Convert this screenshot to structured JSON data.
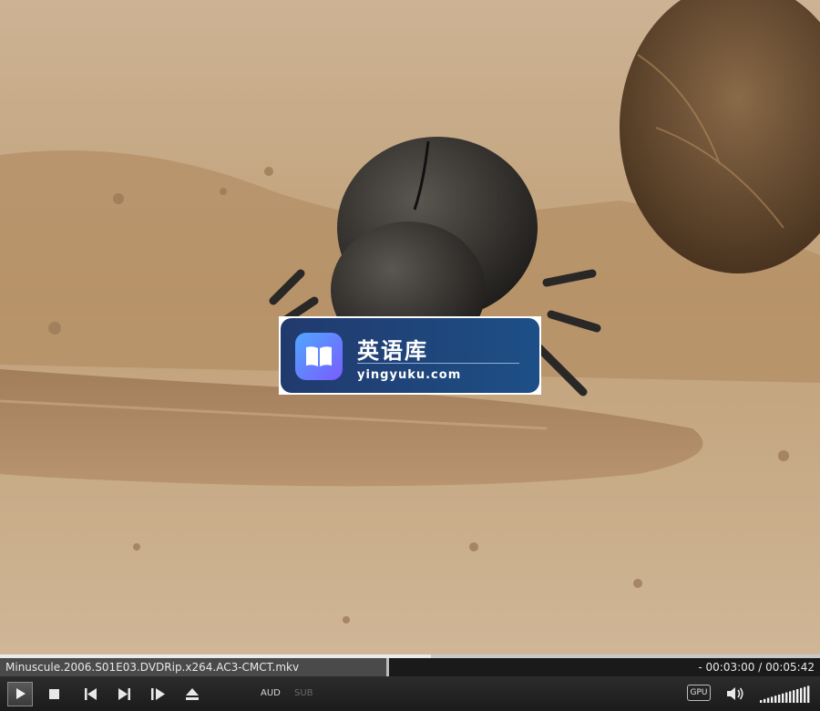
{
  "player": {
    "filename": "Minuscule.2006.S01E03.DVDRip.x264.AC3-CMCT.mkv",
    "time_display": "- 00:03:00 / 00:05:42",
    "progress_fraction": 0.526,
    "aud_label": "AUD",
    "sub_label": "SUB",
    "gpu_label": "GPU",
    "volume_level": 1.0
  },
  "watermark": {
    "title": "英语库",
    "subtitle": "yingyuku.com"
  },
  "icons": {
    "play": "play-icon",
    "stop": "stop-icon",
    "previous": "skip-previous-icon",
    "next": "skip-next-icon",
    "frame_step": "frame-step-icon",
    "eject": "eject-icon",
    "volume": "speaker-icon",
    "volume_bars": "volume-bars-icon",
    "book": "book-icon"
  },
  "colors": {
    "watermark_bg": "#1f4277",
    "controls_bg": "#222222"
  }
}
